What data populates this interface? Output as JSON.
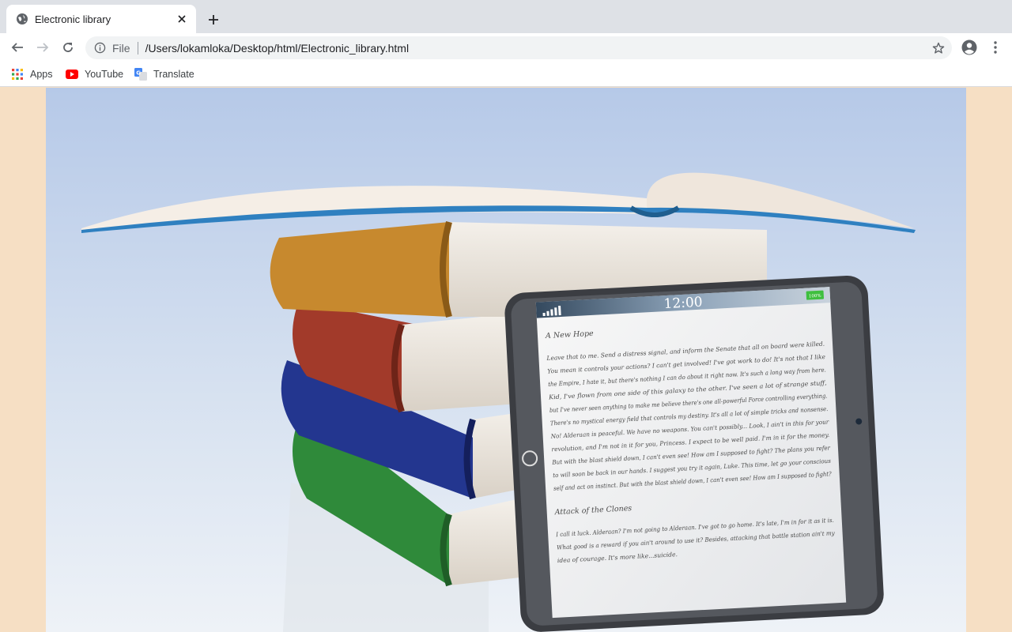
{
  "browser": {
    "tab": {
      "title": "Electronic library",
      "favicon": "globe-icon",
      "close_icon": "close-icon"
    },
    "new_tab_icon": "plus-icon",
    "toolbar": {
      "back_icon": "back-arrow-icon",
      "forward_icon": "forward-arrow-icon",
      "reload_icon": "reload-icon",
      "info_icon": "info-icon",
      "scheme": "File",
      "url": "/Users/lokamloka/Desktop/html/Electronic_library.html",
      "star_icon": "star-icon",
      "profile_icon": "account-circle-icon",
      "menu_icon": "kebab-menu-icon"
    },
    "bookmarks": [
      {
        "label": "Apps",
        "icon": "apps-grid-icon"
      },
      {
        "label": "YouTube",
        "icon": "youtube-icon"
      },
      {
        "label": "Translate",
        "icon": "translate-icon"
      }
    ]
  },
  "page": {
    "background": "#f6dfc4",
    "hero_image": {
      "tablet": {
        "clock": "12:00",
        "battery": "100%",
        "heading_1": "A New Hope",
        "lines_1": [
          "Leave that to me. Send a distress signal, and inform the Senate that all on board were killed.",
          "You mean it controls your actions? I can't get involved! I've got work to do! It's not that I like",
          "the Empire, I hate it, but there's nothing I can do about it right now. It's such a long way from here.",
          "Kid, I've flown from one side of this galaxy to the other. I've seen a lot of strange stuff,",
          "but I've never seen anything to make me believe there's one all-powerful Force controlling everything.",
          "There's no mystical energy field that controls my destiny. It's all a lot of simple tricks and nonsense.",
          "No! Alderaan is peaceful. We have no weapons. You can't possibly... Look, I ain't in this for your",
          "revolution, and I'm not in it for you, Princess. I expect to be well paid. I'm in it for the money.",
          "But with the blast shield down, I can't even see! How am I supposed to fight? The plans you refer",
          "to will soon be back in our hands. I suggest you try it again, Luke. This time, let go your conscious",
          "self and act on instinct. But with the blast shield down, I can't even see! How am I supposed to fight?"
        ],
        "heading_2": "Attack of the Clones",
        "lines_2": [
          "I call it luck. Alderaan? I'm not going to Alderaan. I've got to go home. It's late, I'm in for it as it is.",
          "What good is a reward if you ain't around to use it? Besides, attacking that battle station ain't my",
          "idea of courage. It's more like...suicide."
        ]
      }
    }
  }
}
